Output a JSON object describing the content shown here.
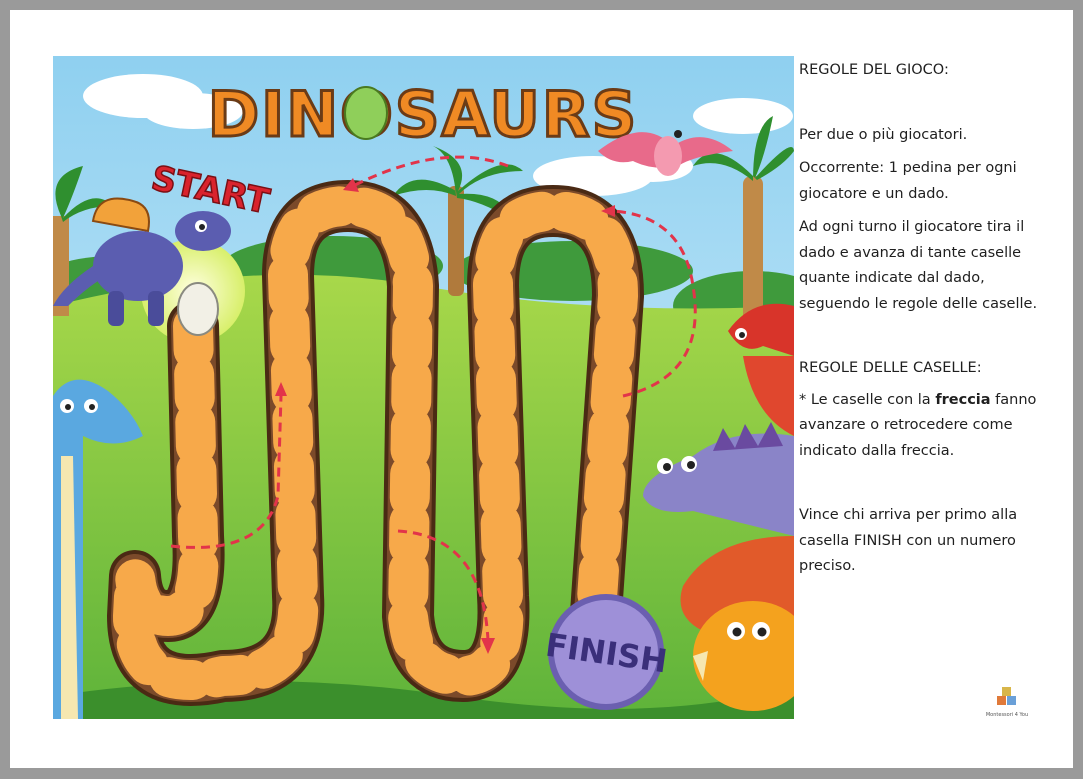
{
  "board": {
    "title": "DINOSAURS",
    "start_label": "START",
    "finish_label": "FINISH"
  },
  "rules": {
    "title": "REGOLE DEL GIOCO:",
    "players": "Per due o più giocatori.",
    "items": "Occorrente: 1 pedina per ogni giocatore e un dado.",
    "turn": "Ad ogni turno il giocatore tira il dado e avanza di tante caselle quante indicate dal dado, seguendo le regole delle caselle.",
    "cells_title": "REGOLE DELLE CASELLE:",
    "arrow_rule_pre": "* Le caselle con la ",
    "arrow_rule_bold": "freccia",
    "arrow_rule_post": " fanno avanzare o retrocedere come indicato dalla freccia.",
    "win": "Vince chi arriva per primo alla casella FINISH con un numero preciso."
  },
  "logo": {
    "caption": "Montessori 4 You"
  },
  "colors": {
    "sky": "#9fd6ee",
    "grass": "#8dc63f",
    "path_dark": "#7b4a2a",
    "path_light": "#f7a94a",
    "title_orange": "#f08a24",
    "start_red": "#d9232d",
    "finish_purple": "#8a78c8",
    "arrow_red": "#e2344a"
  }
}
